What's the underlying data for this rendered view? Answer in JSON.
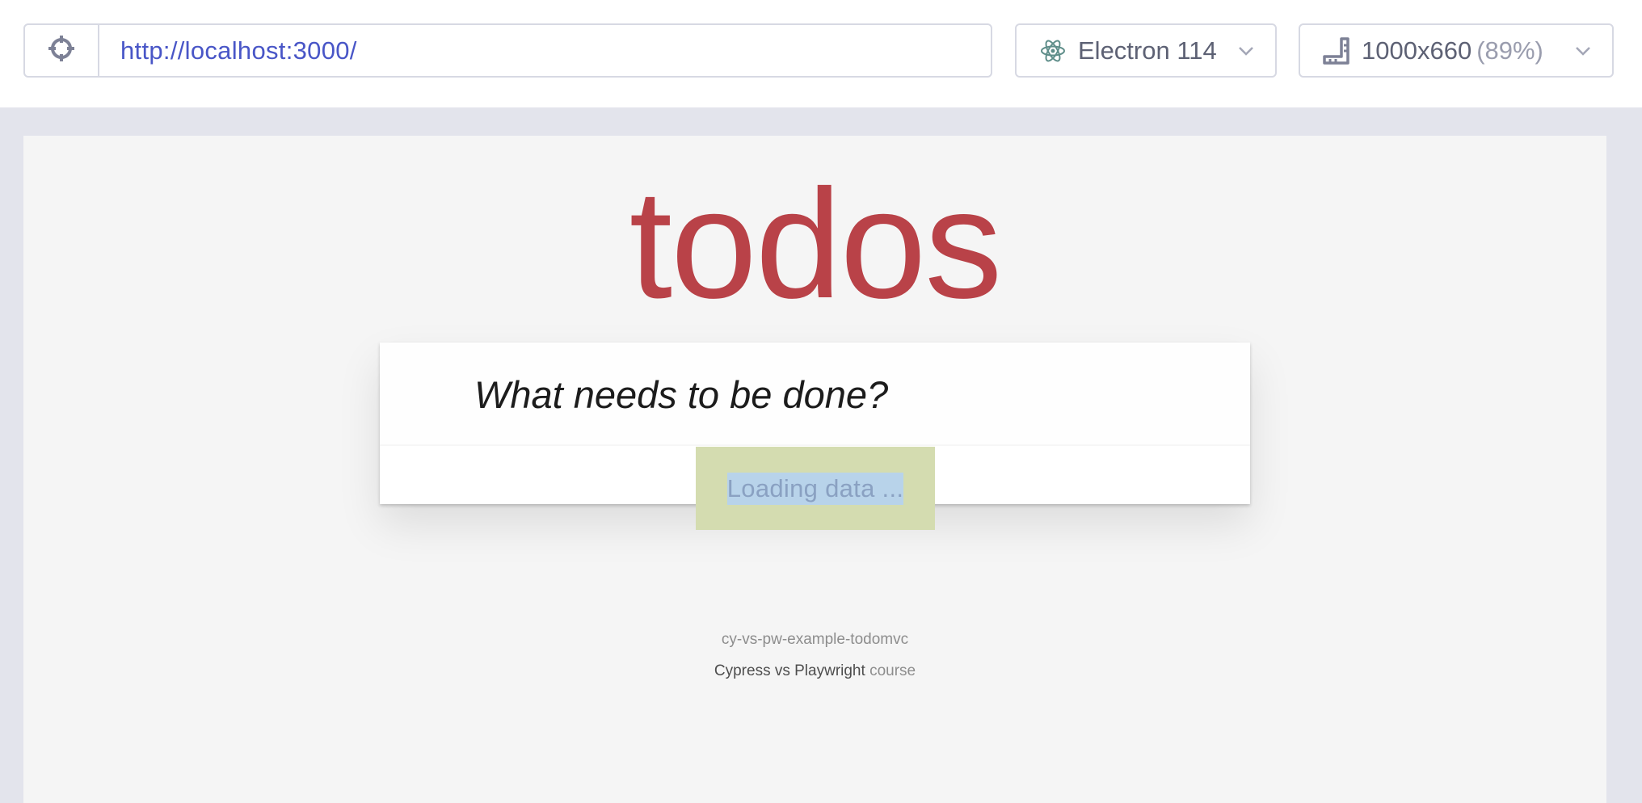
{
  "toolbar": {
    "url": "http://localhost:3000/",
    "browser_label": "Electron 114",
    "browser_icon": "electron-icon",
    "viewport_size": "1000x660",
    "viewport_scale": "(89%)",
    "target_icon": "crosshair-icon",
    "viewport_icon": "ruler-icon"
  },
  "app": {
    "title": "todos",
    "new_todo_placeholder": "What needs to be done?",
    "loading_text": "Loading data ...",
    "footer_line1": "cy-vs-pw-example-todomvc",
    "footer_line2_strong": "Cypress vs Playwright",
    "footer_line2_muted": "course"
  },
  "colors": {
    "brand_red": "#b83f45",
    "url_blue": "#4956c7",
    "loading_bg": "#d4dcb0",
    "loading_highlight": "#b8d3ea"
  }
}
